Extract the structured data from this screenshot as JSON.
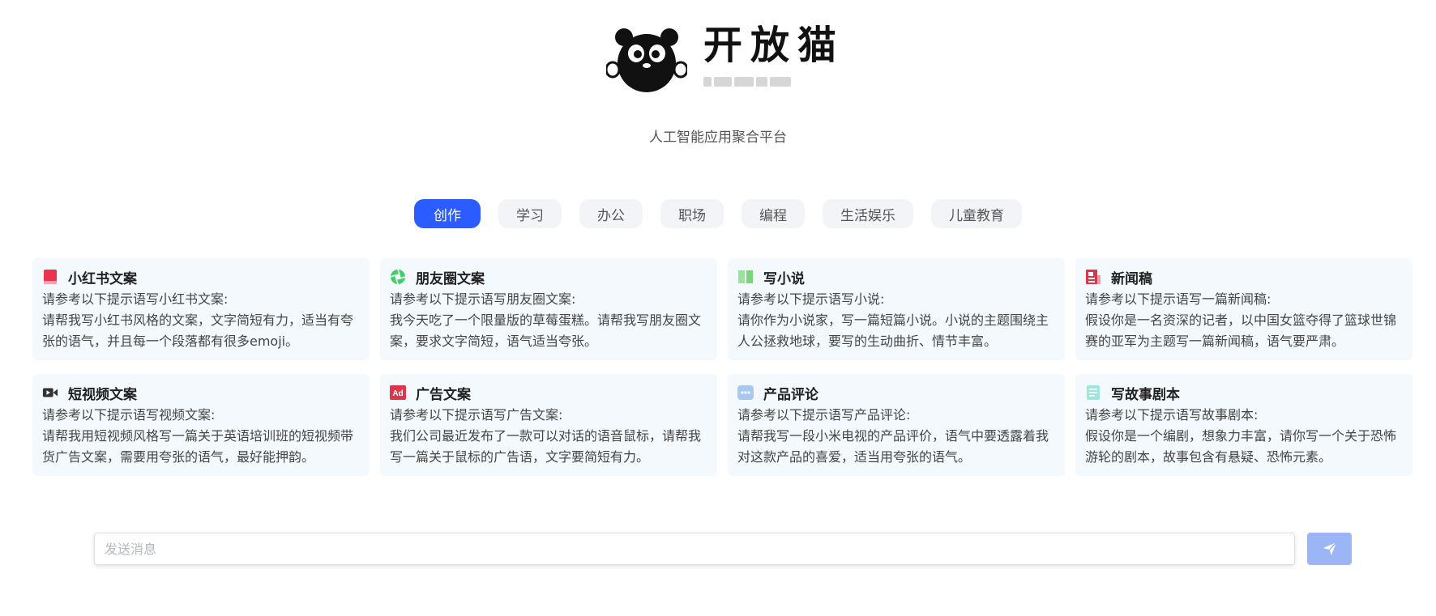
{
  "brand": {
    "name": "开放猫",
    "tagline": "人工智能应用聚合平台"
  },
  "tabs": [
    "创作",
    "学习",
    "办公",
    "职场",
    "编程",
    "生活娱乐",
    "儿童教育"
  ],
  "active_tab": "创作",
  "cards": [
    {
      "title": "小红书文案",
      "icon": "red-book-icon",
      "line1": "请参考以下提示语写小红书文案:",
      "body": "请帮我写小红书风格的文案，文字简短有力，适当有夸张的语气，并且每一个段落都有很多emoji。"
    },
    {
      "title": "朋友圈文案",
      "icon": "aperture-icon",
      "line1": "请参考以下提示语写朋友圈文案:",
      "body": "我今天吃了一个限量版的草莓蛋糕。请帮我写朋友圈文案，要求文字简短，语气适当夸张。"
    },
    {
      "title": "写小说",
      "icon": "open-book-icon",
      "line1": "请参考以下提示语写小说:",
      "body": "请你作为小说家，写一篇短篇小说。小说的主题围绕主人公拯救地球，要写的生动曲折、情节丰富。"
    },
    {
      "title": "新闻稿",
      "icon": "newspaper-icon",
      "line1": "请参考以下提示语写一篇新闻稿:",
      "body": "假设你是一名资深的记者，以中国女篮夺得了篮球世锦赛的亚军为主题写一篇新闻稿，语气要严肃。"
    },
    {
      "title": "短视频文案",
      "icon": "video-camera-icon",
      "line1": "请参考以下提示语写视频文案:",
      "body": "请帮我用短视频风格写一篇关于英语培训班的短视频带货广告文案，需要用夸张的语气，最好能押韵。"
    },
    {
      "title": "广告文案",
      "icon": "ad-icon",
      "line1": "请参考以下提示语写广告文案:",
      "body": "我们公司最近发布了一款可以对话的语音鼠标，请帮我写一篇关于鼠标的广告语，文字要简短有力。"
    },
    {
      "title": "产品评论",
      "icon": "comment-icon",
      "line1": "请参考以下提示语写产品评论:",
      "body": "请帮我写一段小米电视的产品评价，语气中要透露着我对这款产品的喜爱，适当用夸张的语气。"
    },
    {
      "title": "写故事剧本",
      "icon": "script-icon",
      "line1": "请参考以下提示语写故事剧本:",
      "body": "假设你是一个编剧，想象力丰富，请你写一个关于恐怖游轮的剧本，故事包含有悬疑、恐怖元素。"
    }
  ],
  "chat": {
    "placeholder": "发送消息"
  },
  "colors": {
    "accent": "#2a5cff",
    "send_button": "#9cb5f7",
    "card_bg": "#f4f9fd"
  }
}
